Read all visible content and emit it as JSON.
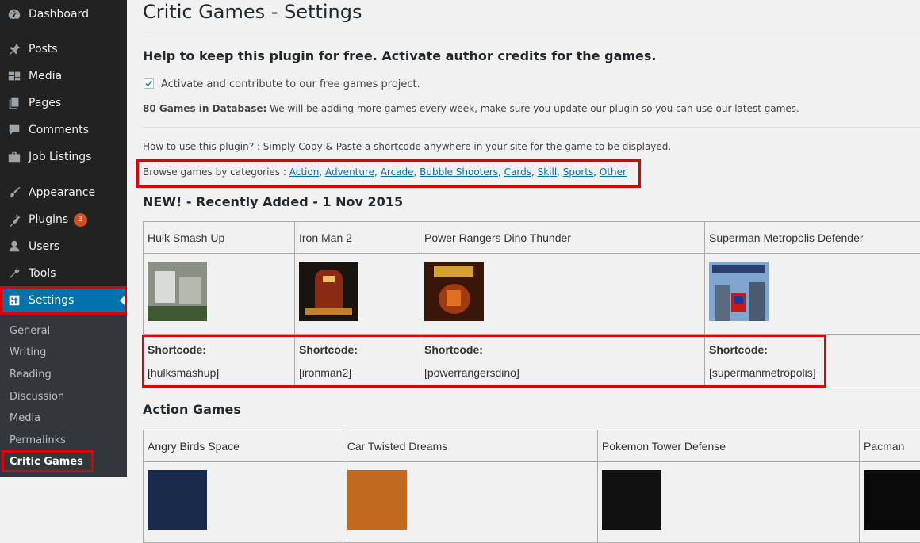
{
  "sidebar": {
    "items": [
      {
        "label": "Dashboard",
        "icon": "dashboard-icon"
      },
      {
        "label": "Posts",
        "icon": "pin-icon"
      },
      {
        "label": "Media",
        "icon": "media-icon"
      },
      {
        "label": "Pages",
        "icon": "pages-icon"
      },
      {
        "label": "Comments",
        "icon": "comments-icon"
      },
      {
        "label": "Job Listings",
        "icon": "briefcase-icon"
      },
      {
        "label": "Appearance",
        "icon": "brush-icon"
      },
      {
        "label": "Plugins",
        "icon": "plugin-icon",
        "badge": "3"
      },
      {
        "label": "Users",
        "icon": "user-icon"
      },
      {
        "label": "Tools",
        "icon": "wrench-icon"
      },
      {
        "label": "Settings",
        "icon": "settings-icon"
      }
    ],
    "submenu": [
      "General",
      "Writing",
      "Reading",
      "Discussion",
      "Media",
      "Permalinks",
      "Critic Games"
    ],
    "colors": {
      "bg": "#222222",
      "active": "#0073aa",
      "submenu_bg": "#32373c",
      "highlight": "#e00000"
    }
  },
  "page": {
    "title": "Critic Games - Settings",
    "help_heading": "Help to keep this plugin for free. Activate author credits for the games.",
    "checkbox_label": "Activate and contribute to our free games project.",
    "checkbox_checked": true,
    "db_count_bold": "80 Games in Database:",
    "db_count_text": " We will be adding more games every week, make sure you update our plugin so you can use our latest games.",
    "howto": "How to use this plugin? : Simply Copy & Paste a shortcode anywhere in your site for the game to be displayed.",
    "browse_label": "Browse games by categories : ",
    "categories": [
      "Action",
      "Adventure",
      "Arcade",
      "Bubble Shooters",
      "Cards",
      "Skill",
      "Sports",
      "Other"
    ],
    "recent_heading": "NEW! - Recently Added - 1 Nov 2015",
    "shortcode_label": "Shortcode:",
    "recent_games": [
      {
        "name": "Hulk Smash Up",
        "shortcode": "[hulksmashup]",
        "thumb": "hulk-thumbnail"
      },
      {
        "name": "Iron Man 2",
        "shortcode": "[ironman2]",
        "thumb": "ironman-thumbnail"
      },
      {
        "name": "Power Rangers Dino Thunder",
        "shortcode": "[powerrangersdino]",
        "thumb": "powerrangers-thumbnail"
      },
      {
        "name": "Superman Metropolis Defender",
        "shortcode": "[supermanmetropolis]",
        "thumb": "superman-thumbnail"
      }
    ],
    "action_heading": "Action Games",
    "action_games": [
      {
        "name": "Angry Birds Space"
      },
      {
        "name": "Car Twisted Dreams"
      },
      {
        "name": "Pokemon Tower Defense"
      },
      {
        "name": "Pacman"
      }
    ]
  }
}
